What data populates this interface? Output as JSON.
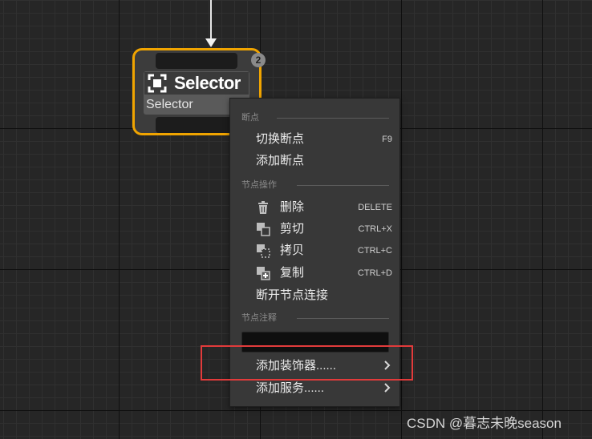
{
  "node": {
    "badge": "2",
    "title": "Selector",
    "subtitle": "Selector",
    "icon": "selector-icon",
    "border_color": "#f0a400"
  },
  "context_menu": {
    "sections": [
      {
        "header": "断点",
        "items": [
          {
            "label": "切换断点",
            "shortcut": "F9"
          },
          {
            "label": "添加断点",
            "shortcut": ""
          }
        ]
      },
      {
        "header": "节点操作",
        "items": [
          {
            "label": "删除",
            "shortcut": "DELETE",
            "icon": "trash-icon"
          },
          {
            "label": "剪切",
            "shortcut": "CTRL+X",
            "icon": "cut-icon"
          },
          {
            "label": "拷贝",
            "shortcut": "CTRL+C",
            "icon": "copy-icon"
          },
          {
            "label": "复制",
            "shortcut": "CTRL+D",
            "icon": "duplicate-icon"
          },
          {
            "label": "断开节点连接",
            "shortcut": ""
          }
        ]
      },
      {
        "header": "节点注释",
        "note_value": "",
        "items": [
          {
            "label": "添加装饰器......",
            "submenu": true
          },
          {
            "label": "添加服务......",
            "submenu": true
          }
        ]
      }
    ]
  },
  "highlight_color": "#e23b3b",
  "watermark": "CSDN @暮志未晚season"
}
